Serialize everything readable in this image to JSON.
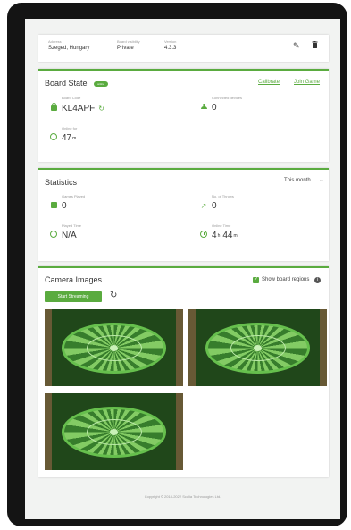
{
  "board": {
    "address_label": "Address",
    "address": "Szeged, Hungary",
    "visibility_label": "Board visibility",
    "visibility": "Private",
    "version_label": "Version",
    "version": "4.3.3",
    "edit_icon": "pencil-icon",
    "delete_icon": "trash-icon"
  },
  "board_state": {
    "title": "Board State",
    "badge": "online",
    "calibrate": "Calibrate",
    "join_game": "Join Game",
    "board_code_label": "Board Code",
    "board_code": "KL4APF",
    "connected_label": "Connected devices",
    "connected": "0",
    "online_for_label": "Online for",
    "online_for_value": "47",
    "online_for_unit": "m"
  },
  "statistics": {
    "title": "Statistics",
    "period": "This month",
    "games_label": "Games Played",
    "games": "0",
    "throws_label": "No. of Throws",
    "throws": "0",
    "played_time_label": "Played Time",
    "played_time": "N/A",
    "online_time_label": "Online Time",
    "online_time_h": "4",
    "online_time_h_unit": "h",
    "online_time_m": "44",
    "online_time_m_unit": "m"
  },
  "camera": {
    "title": "Camera Images",
    "start_streaming": "Start Streaming",
    "show_regions": "Show board regions"
  },
  "footer": "Copyright © 2018-2022 Scolia Technologies Ltd.",
  "colors": {
    "accent": "#5aab3f",
    "device": "#141414"
  }
}
